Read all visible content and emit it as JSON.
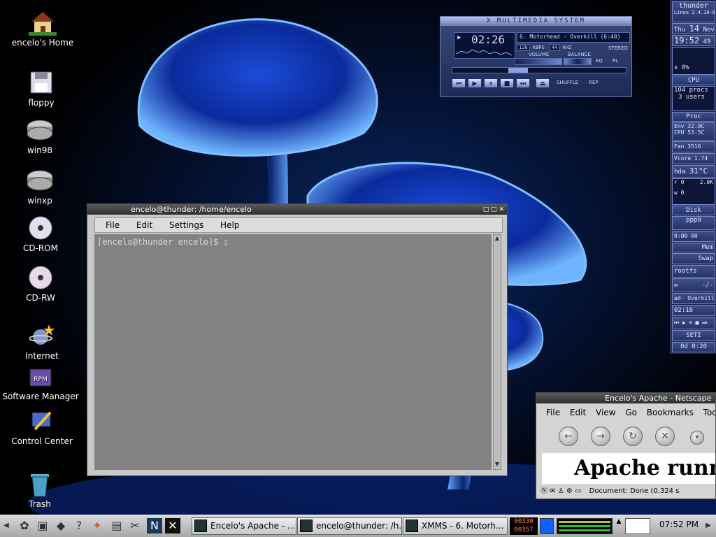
{
  "desktop_icons": [
    {
      "label": "encelo's Home",
      "icon": "home-icon"
    },
    {
      "label": "floppy",
      "icon": "floppy-icon"
    },
    {
      "label": "win98",
      "icon": "harddrive-icon"
    },
    {
      "label": "winxp",
      "icon": "harddrive-icon"
    },
    {
      "label": "CD-ROM",
      "icon": "cdrom-icon"
    },
    {
      "label": "CD-RW",
      "icon": "cdrw-icon"
    },
    {
      "label": "Internet",
      "icon": "internet-icon"
    },
    {
      "label": "Software Manager",
      "icon": "rpm-package-icon"
    },
    {
      "label": "Control Center",
      "icon": "control-center-icon"
    },
    {
      "label": "Trash",
      "icon": "trash-icon"
    }
  ],
  "xmms": {
    "title": "XMMS - X MULTIMEDIA SYSTEM",
    "title_display": "X MULTIMEDIA SYSTEM",
    "time": "02:26",
    "track": "6. Motorhead - Overkill (6:40)",
    "kbps": "128",
    "kbps_unit": "KBPS",
    "khz": "44",
    "khz_unit": "KHZ",
    "stereo": "STEREO",
    "volume_label": "VOLUME",
    "balance_label": "BALANCE",
    "eq": "EQ",
    "pl": "PL",
    "shuffle": "SHUFFLE",
    "rep": "REP",
    "buttons": [
      "⏮",
      "▶",
      "⏸",
      "■",
      "⏭",
      "⏏"
    ]
  },
  "gkrellm": {
    "host": "thunder",
    "kernel": "Linux 2.4.18-6",
    "date_day": "Thu",
    "date_num": "14",
    "date_mon": "Nov",
    "time": "19:52",
    "seconds": "49",
    "cpu_label": "CPU",
    "procs": "104 procs",
    "users": "3 users",
    "proc_label": "Proc",
    "env": "Env   32.0C",
    "cpu_temp": "CPU   53.5C",
    "fan": "Fan    3516",
    "vcore": "Vcore   1.74",
    "hda_label": "hda",
    "hda_temp": "31°C",
    "r": "r 0",
    "r_rate": "2.0K",
    "w": "w 0",
    "disk_label": "Disk",
    "ppp": "ppp0",
    "ppp_time": "0:00 00",
    "mem_label": "Mem",
    "swap_label": "Swap",
    "rootfs": "rootfs",
    "mail": "-/-",
    "track": "ad- Overkill (6:",
    "track_time": "02:16",
    "seti": "SETI",
    "seti_time": "0d  0:20",
    "s_label": "s 0%"
  },
  "terminal": {
    "title": "encelo@thunder: /home/encelo",
    "menu": [
      "File",
      "Edit",
      "Settings",
      "Help"
    ],
    "prompt": "[encelo@thunder encelo]$ ▯"
  },
  "netscape": {
    "title": "Encelo's Apache - Netscape",
    "menu": [
      "File",
      "Edit",
      "View",
      "Go",
      "Bookmarks",
      "Tools"
    ],
    "content": "Apache running",
    "status": "Document: Done (0.324 s"
  },
  "taskbar": {
    "tasks": [
      {
        "label": "Encelo's Apache - ..."
      },
      {
        "label": "encelo@thunder: /h..."
      },
      {
        "label": "XMMS - 6. Motorh..."
      }
    ],
    "counter_top": "00330",
    "counter_bottom": "00357",
    "clock": "07:52 PM"
  }
}
